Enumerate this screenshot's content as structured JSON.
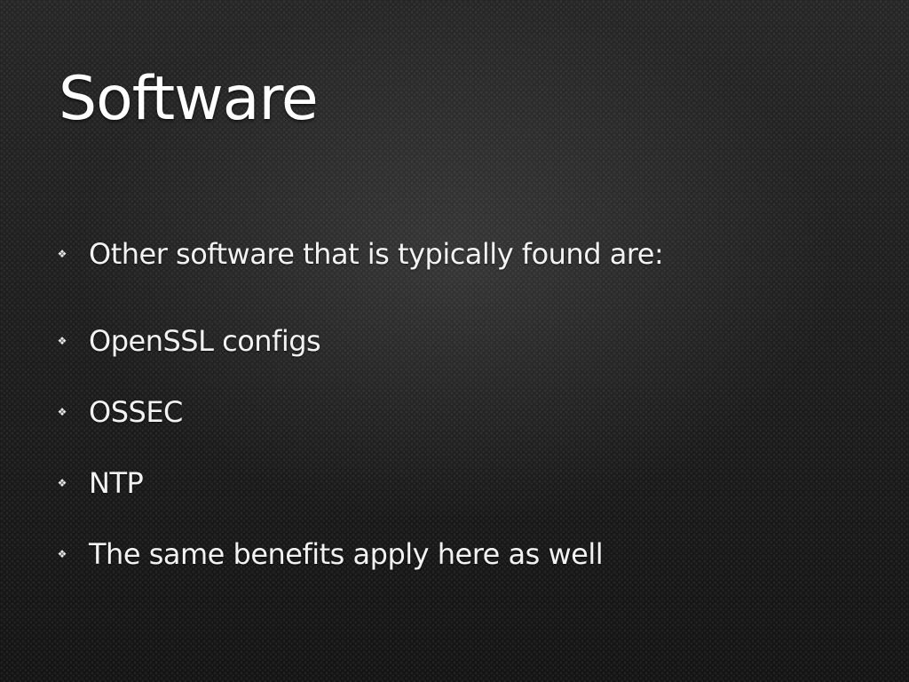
{
  "slide": {
    "title": "Software",
    "bullet_icon": "bullet-ornament-icon",
    "bullets": [
      "Other software that is typically found are:",
      "OpenSSL configs",
      "OSSEC",
      "NTP",
      "The same benefits apply here as well"
    ]
  },
  "colors": {
    "background": "#1c1c1c",
    "text": "#ffffff"
  }
}
